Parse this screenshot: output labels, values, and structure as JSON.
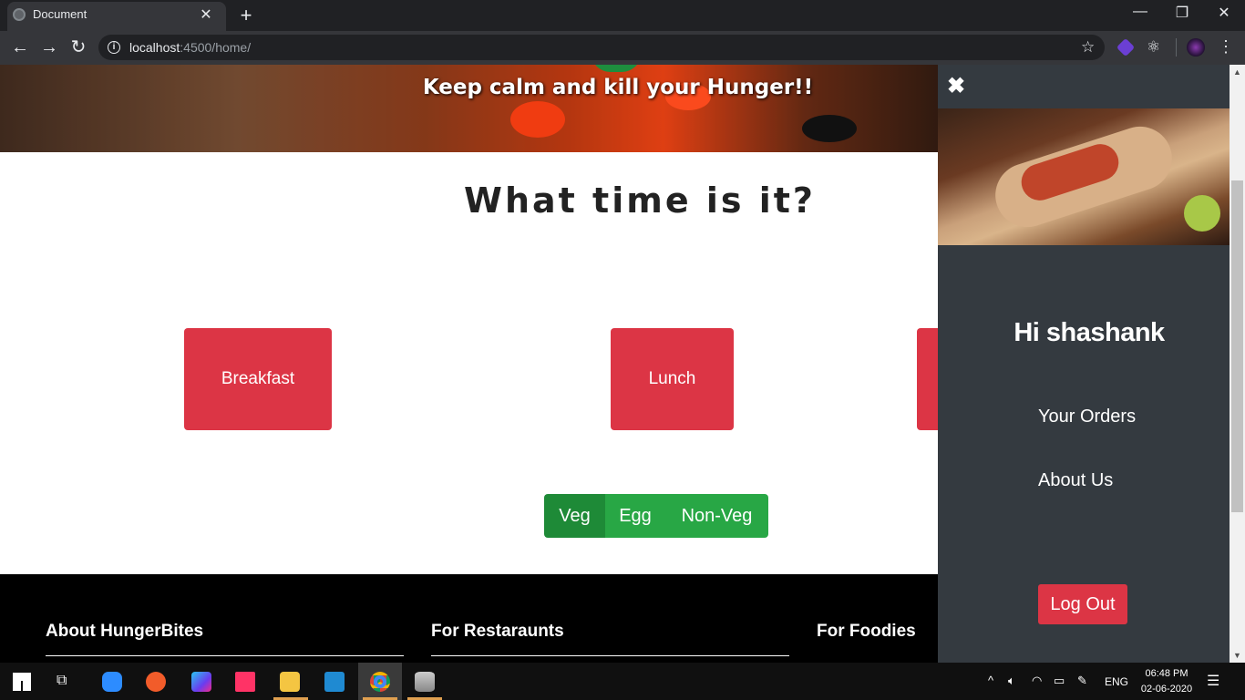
{
  "browser": {
    "tab_title": "Document",
    "url_host": "localhost",
    "url_rest": ":4500/home/"
  },
  "hero": {
    "tagline": "Keep calm and kill your Hunger!!"
  },
  "main": {
    "heading": "What time is it?",
    "meals": [
      "Breakfast",
      "Lunch"
    ],
    "diet_options": [
      "Veg",
      "Egg",
      "Non-Veg"
    ],
    "diet_selected": "Veg"
  },
  "footer": {
    "columns": [
      "About HungerBites",
      "For Restaraunts",
      "For Foodies"
    ]
  },
  "sidebar": {
    "greeting": "Hi shashank",
    "links": [
      "Your Orders",
      "About Us"
    ],
    "logout_label": "Log Out"
  },
  "taskbar": {
    "language": "ENG",
    "time": "06:48 PM",
    "date": "02-06-2020"
  },
  "colors": {
    "danger": "#dc3545",
    "success": "#28a745",
    "sidebar_bg": "#343a40"
  }
}
